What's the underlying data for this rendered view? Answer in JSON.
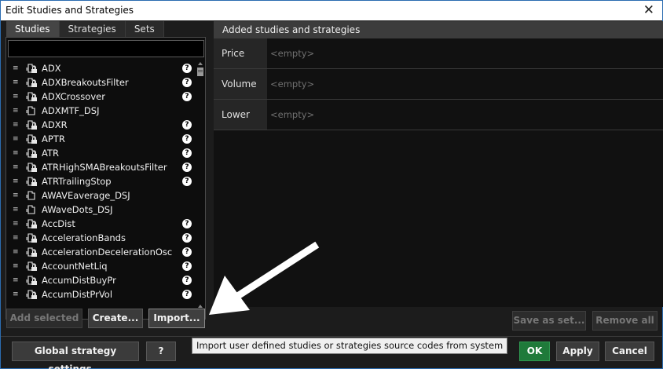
{
  "window": {
    "title": "Edit Studies and Strategies",
    "close_glyph": "✕"
  },
  "tabs": [
    {
      "label": "Studies",
      "active": true
    },
    {
      "label": "Strategies",
      "active": false
    },
    {
      "label": "Sets",
      "active": false
    }
  ],
  "search": {
    "value": "",
    "placeholder": ""
  },
  "studies": [
    {
      "label": "ADX",
      "help": true,
      "icon": "locked-study-icon"
    },
    {
      "label": "ADXBreakoutsFilter",
      "help": true,
      "icon": "locked-study-icon"
    },
    {
      "label": "ADXCrossover",
      "help": true,
      "icon": "locked-study-icon"
    },
    {
      "label": "ADXMTF_DSJ",
      "help": false,
      "icon": "study-icon"
    },
    {
      "label": "ADXR",
      "help": true,
      "icon": "locked-study-icon"
    },
    {
      "label": "APTR",
      "help": true,
      "icon": "locked-study-icon"
    },
    {
      "label": "ATR",
      "help": true,
      "icon": "locked-study-icon"
    },
    {
      "label": "ATRHighSMABreakoutsFilter",
      "help": true,
      "icon": "locked-study-icon"
    },
    {
      "label": "ATRTrailingStop",
      "help": true,
      "icon": "locked-study-icon"
    },
    {
      "label": "AWAVEaverage_DSJ",
      "help": false,
      "icon": "study-icon"
    },
    {
      "label": "AWaveDots_DSJ",
      "help": false,
      "icon": "study-icon"
    },
    {
      "label": "AccDist",
      "help": true,
      "icon": "locked-study-icon"
    },
    {
      "label": "AccelerationBands",
      "help": true,
      "icon": "locked-study-icon"
    },
    {
      "label": "AccelerationDecelerationOsc",
      "help": true,
      "icon": "locked-study-icon"
    },
    {
      "label": "AccountNetLiq",
      "help": true,
      "icon": "locked-study-icon"
    },
    {
      "label": "AccumDistBuyPr",
      "help": true,
      "icon": "locked-study-icon"
    },
    {
      "label": "AccumDistPrVol",
      "help": true,
      "icon": "locked-study-icon"
    }
  ],
  "help_glyph": "?",
  "grip_glyph": "≡",
  "added_panel": {
    "header": "Added studies and strategies",
    "slots": [
      {
        "label": "Price",
        "value": "<empty>"
      },
      {
        "label": "Volume",
        "value": "<empty>"
      },
      {
        "label": "Lower",
        "value": "<empty>"
      }
    ]
  },
  "buttons": {
    "add_selected": "Add selected",
    "create": "Create...",
    "import": "Import...",
    "save_as_set": "Save as set...",
    "remove_all": "Remove all",
    "global_settings": "Global strategy settings...",
    "help": "?",
    "ok": "OK",
    "apply": "Apply",
    "cancel": "Cancel"
  },
  "tooltip": "Import user defined studies or strategies source codes from system",
  "colors": {
    "background": "#1c1c1c",
    "panel_header": "#3c3c3c",
    "ok_green": "#1f7a3a",
    "window_border": "#2b6cb0"
  }
}
